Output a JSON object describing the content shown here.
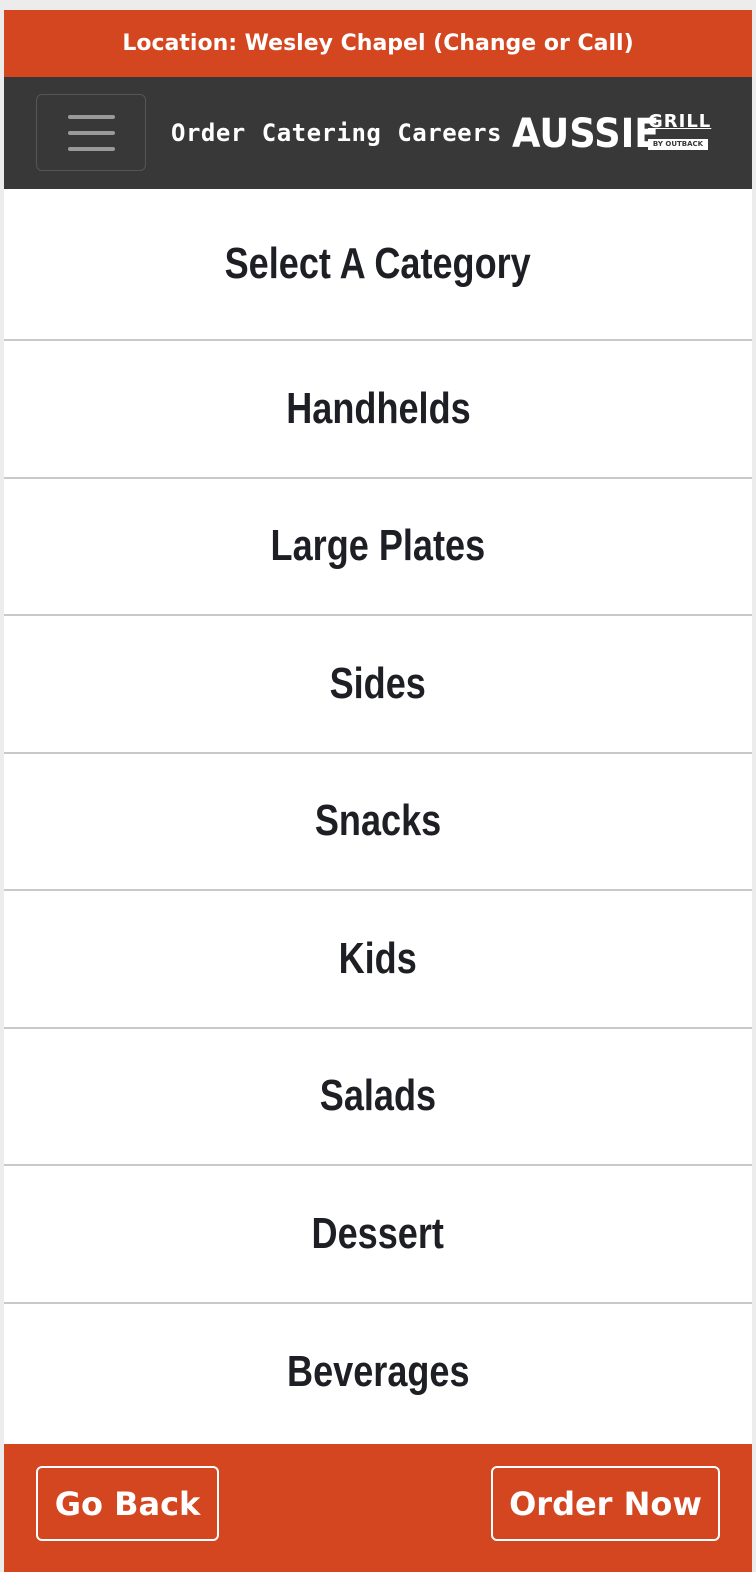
{
  "location_bar": {
    "text": "Location: Wesley Chapel (Change or Call)"
  },
  "navbar": {
    "menu_icon": "hamburger-menu-icon",
    "links": [
      {
        "label": "Order"
      },
      {
        "label": "Catering"
      },
      {
        "label": "Careers"
      }
    ],
    "logo": {
      "main": "AUSSIE",
      "sub": "GRILL",
      "tag": "BY OUTBACK"
    }
  },
  "categories": {
    "heading": "Select A Category",
    "items": [
      {
        "label": "Handhelds"
      },
      {
        "label": "Large Plates"
      },
      {
        "label": "Sides"
      },
      {
        "label": "Snacks"
      },
      {
        "label": "Kids"
      },
      {
        "label": "Salads"
      },
      {
        "label": "Dessert"
      },
      {
        "label": "Beverages"
      }
    ]
  },
  "footer": {
    "back_label": "Go Back",
    "order_label": "Order Now"
  },
  "colors": {
    "brand_orange": "#d4461f",
    "nav_background": "#383838",
    "text_dark": "#1e1f24",
    "divider": "#c9c9c9"
  }
}
